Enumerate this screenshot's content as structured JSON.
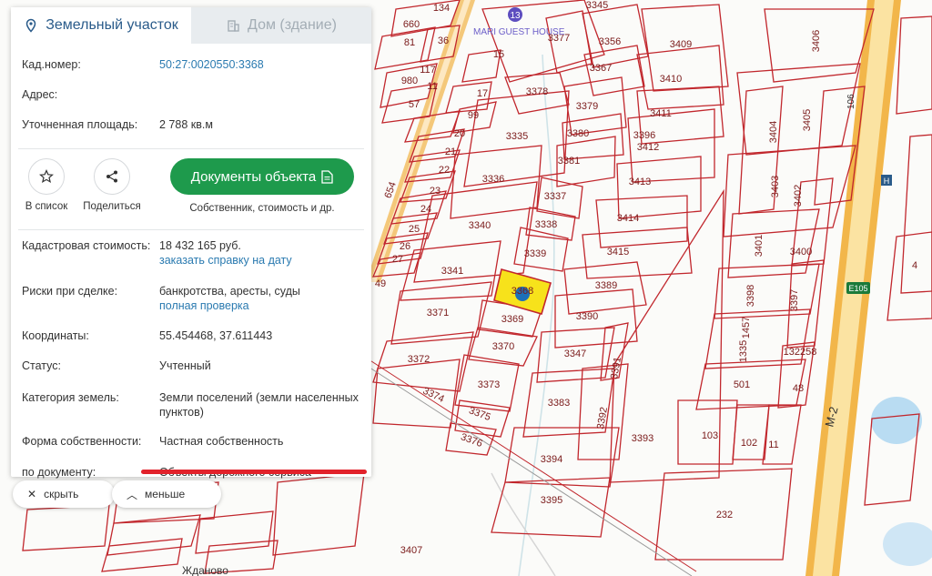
{
  "tabs": [
    {
      "label": "Земельный участок",
      "icon": "map-pin-icon"
    },
    {
      "label": "Дом (здание)",
      "icon": "building-icon"
    }
  ],
  "top_info": [
    {
      "label": "Кад.номер:",
      "value": "50:27:0020550:3368",
      "link": true
    },
    {
      "label": "Адрес:",
      "value": ""
    },
    {
      "label": "Уточненная площадь:",
      "value": "2 788 кв.м"
    }
  ],
  "actions": {
    "to_list": "В список",
    "share": "Поделиться",
    "documents_button": "Документы объекта",
    "documents_sub": "Собственник, стоимость и др."
  },
  "details": [
    {
      "label": "Кадастровая стоимость:",
      "value": "18 432 165 руб.",
      "link": "заказать справку на дату"
    },
    {
      "label": "Риски при сделке:",
      "value": "банкротства, аресты, суды",
      "link": "полная проверка"
    },
    {
      "label": "Координаты:",
      "value": "55.454468, 37.611443"
    },
    {
      "label": "Статус:",
      "value": "Учтенный"
    },
    {
      "label": "Категория земель:",
      "value": "Земли поселений (земли населенных пунктов)"
    },
    {
      "label": "Форма собственности:",
      "value": "Частная собственность"
    },
    {
      "label": "по документу:",
      "value": "Объекты дорожного сервиса"
    }
  ],
  "bottom_buttons": {
    "hide": "скрыть",
    "less": "меньше"
  },
  "colors": {
    "accent_green": "#1e9a4c",
    "link_blue": "#2a7ab0",
    "parcel_red": "#c1272d",
    "highway_orange": "#f0b040",
    "selected_yellow": "#f7e21b",
    "marker_blue": "#1d6fb8"
  },
  "map": {
    "road_labels": [
      "M-2",
      "E105",
      "106"
    ],
    "poi": {
      "badge": "13",
      "text": "MARI GUEST HOUSE",
      "letter": "H"
    },
    "place_label": "Жданово",
    "parcels": [
      {
        "label": "134"
      },
      {
        "label": "660"
      },
      {
        "label": "36"
      },
      {
        "label": "81"
      },
      {
        "label": "15"
      },
      {
        "label": "117"
      },
      {
        "label": "980"
      },
      {
        "label": "11"
      },
      {
        "label": "17"
      },
      {
        "label": "57"
      },
      {
        "label": "99"
      },
      {
        "label": "20"
      },
      {
        "label": "21"
      },
      {
        "label": "22"
      },
      {
        "label": "23"
      },
      {
        "label": "24"
      },
      {
        "label": "25"
      },
      {
        "label": "26"
      },
      {
        "label": "27"
      },
      {
        "label": "654"
      },
      {
        "label": "49"
      },
      {
        "label": "3345"
      },
      {
        "label": "3377"
      },
      {
        "label": "3356"
      },
      {
        "label": "3367"
      },
      {
        "label": "3409"
      },
      {
        "label": "3378"
      },
      {
        "label": "3410"
      },
      {
        "label": "3379"
      },
      {
        "label": "3411"
      },
      {
        "label": "3335"
      },
      {
        "label": "3380"
      },
      {
        "label": "3412"
      },
      {
        "label": "3381"
      },
      {
        "label": "3336"
      },
      {
        "label": "3413"
      },
      {
        "label": "3337"
      },
      {
        "label": "3338"
      },
      {
        "label": "3340"
      },
      {
        "label": "3414"
      },
      {
        "label": "3339"
      },
      {
        "label": "3415"
      },
      {
        "label": "3341"
      },
      {
        "label": "3368"
      },
      {
        "label": "3389"
      },
      {
        "label": "3371"
      },
      {
        "label": "3369"
      },
      {
        "label": "3390"
      },
      {
        "label": "3370"
      },
      {
        "label": "3372"
      },
      {
        "label": "3347"
      },
      {
        "label": "3391"
      },
      {
        "label": "3373"
      },
      {
        "label": "3374"
      },
      {
        "label": "3383"
      },
      {
        "label": "3375"
      },
      {
        "label": "3392"
      },
      {
        "label": "3376"
      },
      {
        "label": "3393"
      },
      {
        "label": "3394"
      },
      {
        "label": "3395"
      },
      {
        "label": "3396"
      },
      {
        "label": "232"
      },
      {
        "label": "3407"
      },
      {
        "label": "3406"
      },
      {
        "label": "3405"
      },
      {
        "label": "3404"
      },
      {
        "label": "3403"
      },
      {
        "label": "3402"
      },
      {
        "label": "3401"
      },
      {
        "label": "3400"
      },
      {
        "label": "3398"
      },
      {
        "label": "3397"
      },
      {
        "label": "1457"
      },
      {
        "label": "1335"
      },
      {
        "label": "132258"
      },
      {
        "label": "501"
      },
      {
        "label": "48"
      },
      {
        "label": "103"
      },
      {
        "label": "102"
      },
      {
        "label": "11"
      },
      {
        "label": "4"
      }
    ]
  }
}
